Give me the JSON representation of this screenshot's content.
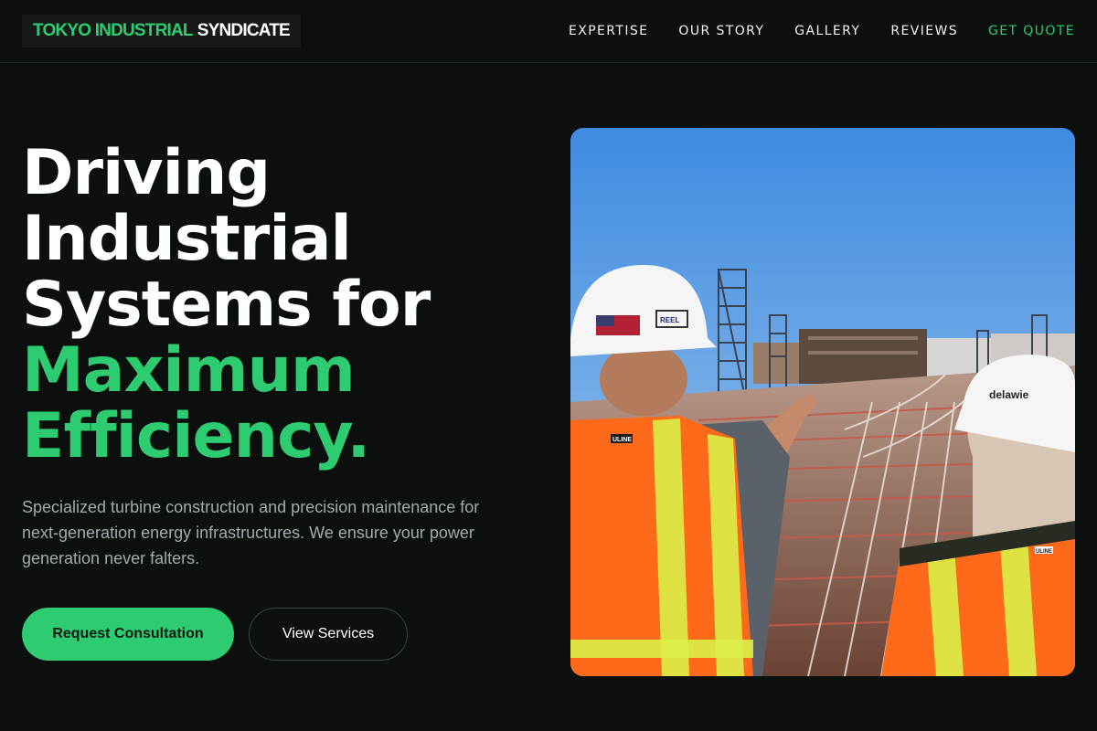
{
  "header": {
    "logo_primary": "TOKYO INDUSTRIAL",
    "logo_secondary": "SYNDICATE",
    "nav": {
      "expertise": "EXPERTISE",
      "our_story": "OUR STORY",
      "gallery": "GALLERY",
      "reviews": "REVIEWS",
      "get_quote": "GET QUOTE"
    }
  },
  "hero": {
    "headline_line1": "Driving",
    "headline_line2": "Industrial",
    "headline_line3": "Systems for",
    "headline_accent1": "Maximum",
    "headline_accent2": "Efficiency.",
    "subtitle": "Specialized turbine construction and precision maintenance for next-generation energy infrastructures. We ensure your power generation never falters.",
    "primary_button": "Request Consultation",
    "secondary_button": "View Services"
  },
  "image": {
    "helmet_label": "delawie",
    "vest_label_left": "ULINE",
    "vest_label_right": "ULINE",
    "helmet_sticker": "REEL"
  },
  "colors": {
    "background": "#0b0f0e",
    "accent": "#2ecc71",
    "muted_text": "#a3abb0",
    "vest_orange": "#ff6a1a",
    "sky": "#5b9be0"
  }
}
